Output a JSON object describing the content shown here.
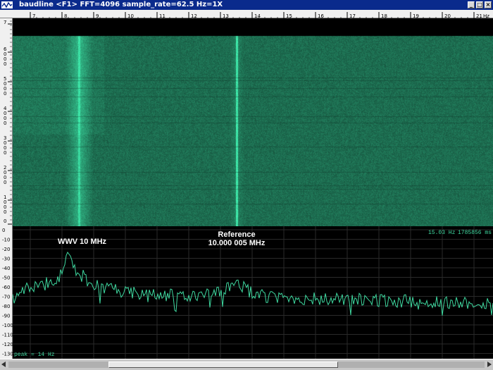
{
  "window": {
    "title": "baudline  <F1> FFT=4096 sample_rate=62.5 Hz=1X",
    "buttons": [
      "minimize",
      "maximize",
      "close"
    ]
  },
  "freq_ruler": {
    "labels": [
      "7",
      "8",
      "9",
      "10",
      "11",
      "12",
      "13",
      "14",
      "15",
      "16",
      "17",
      "18",
      "19",
      "20",
      "21"
    ],
    "unit": "Hz"
  },
  "time_ruler": {
    "labels": [
      "7",
      "6\n0\n0\n0",
      "5\n0\n0\n0",
      "4\n0\n0\n0",
      "3\n0\n0\n0",
      "2\n0\n0\n0",
      "1\n0\n0\n0",
      "0"
    ]
  },
  "spectrum": {
    "top_right_freq": "15.03 Hz",
    "top_right_time": "1785856 ms",
    "bottom_left": "peak =    14 Hz",
    "db_labels": [
      "0",
      "-10",
      "-20",
      "-30",
      "-40",
      "-50",
      "-60",
      "-70",
      "-80",
      "-90",
      "-100",
      "-110",
      "-120",
      "-130"
    ],
    "annotations": {
      "wwv": "WWV 10 MHz",
      "ref_line1": "Reference",
      "ref_line2": "10.000 005 MHz"
    }
  },
  "colors": {
    "trace": "#3fd9a0",
    "waterfall_base": "#0c6e4e",
    "titlebar": "#0a2a8c"
  }
}
